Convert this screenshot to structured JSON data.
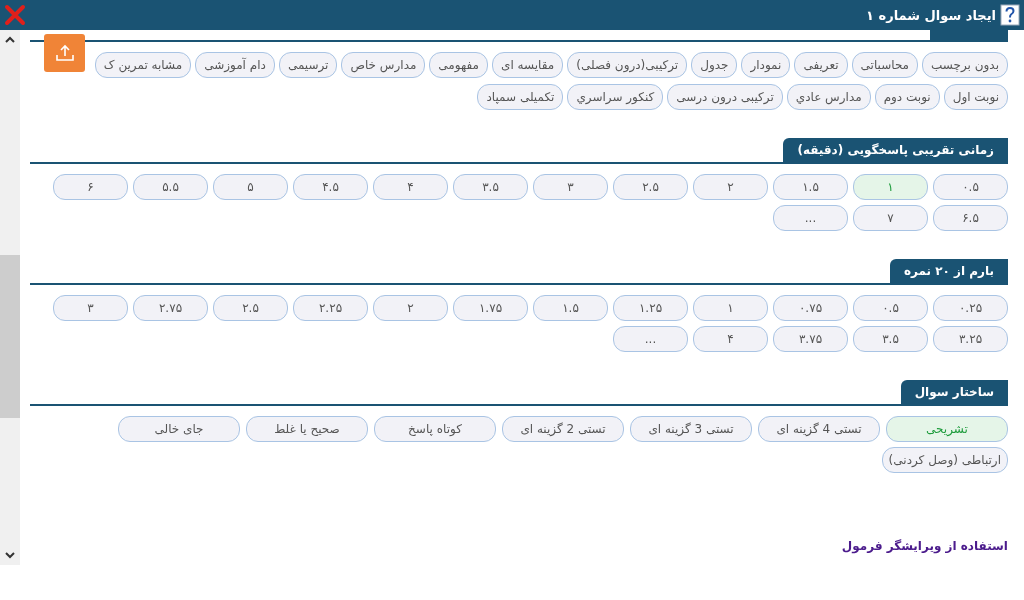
{
  "window": {
    "title": "ایجاد سوال شماره ۱"
  },
  "sections": [
    {
      "kind": "tags",
      "items": [
        {
          "label": "بدون برچسب",
          "selected": false
        },
        {
          "label": "محاسباتی",
          "selected": false
        },
        {
          "label": "تعریفی",
          "selected": false
        },
        {
          "label": "نمودار",
          "selected": false
        },
        {
          "label": "جدول",
          "selected": false
        },
        {
          "label": "ترکیبی(درون فصلی)",
          "selected": false
        },
        {
          "label": "مقایسه ای",
          "selected": false
        },
        {
          "label": "مفهومی",
          "selected": false
        },
        {
          "label": "مدارس خاص",
          "selected": false
        },
        {
          "label": "ترسیمی",
          "selected": false
        },
        {
          "label": "دام آموزشی",
          "selected": false
        },
        {
          "label": "مشابه تمرین ک",
          "selected": false
        },
        {
          "label": "نوبت اول",
          "selected": false
        },
        {
          "label": "نوبت دوم",
          "selected": false
        },
        {
          "label": "مدارس عادي",
          "selected": false
        },
        {
          "label": "ترکیبی درون درسی",
          "selected": false
        },
        {
          "label": "کنکور سراسري",
          "selected": false
        },
        {
          "label": "تکمیلی سمپاد",
          "selected": false
        }
      ]
    },
    {
      "kind": "grid",
      "title": "زمانی تقریبی پاسخگویی (دقیقه)",
      "items": [
        {
          "label": "۰.۵",
          "selected": false
        },
        {
          "label": "۱",
          "selected": true
        },
        {
          "label": "۱.۵",
          "selected": false
        },
        {
          "label": "۲",
          "selected": false
        },
        {
          "label": "۲.۵",
          "selected": false
        },
        {
          "label": "۳",
          "selected": false
        },
        {
          "label": "۳.۵",
          "selected": false
        },
        {
          "label": "۴",
          "selected": false
        },
        {
          "label": "۴.۵",
          "selected": false
        },
        {
          "label": "۵",
          "selected": false
        },
        {
          "label": "۵.۵",
          "selected": false
        },
        {
          "label": "۶",
          "selected": false
        },
        {
          "label": "۶.۵",
          "selected": false
        },
        {
          "label": "۷",
          "selected": false
        },
        {
          "label": "...",
          "selected": false
        }
      ]
    },
    {
      "kind": "grid",
      "title": "بارم از ۲۰ نمره",
      "items": [
        {
          "label": "۰.۲۵",
          "selected": false
        },
        {
          "label": "۰.۵",
          "selected": false
        },
        {
          "label": "۰.۷۵",
          "selected": false
        },
        {
          "label": "۱",
          "selected": false
        },
        {
          "label": "۱.۲۵",
          "selected": false
        },
        {
          "label": "۱.۵",
          "selected": false
        },
        {
          "label": "۱.۷۵",
          "selected": false
        },
        {
          "label": "۲",
          "selected": false
        },
        {
          "label": "۲.۲۵",
          "selected": false
        },
        {
          "label": "۲.۵",
          "selected": false
        },
        {
          "label": "۲.۷۵",
          "selected": false
        },
        {
          "label": "۳",
          "selected": false
        },
        {
          "label": "۳.۲۵",
          "selected": false
        },
        {
          "label": "۳.۵",
          "selected": false
        },
        {
          "label": "۳.۷۵",
          "selected": false
        },
        {
          "label": "۴",
          "selected": false
        },
        {
          "label": "...",
          "selected": false
        }
      ]
    },
    {
      "kind": "wide",
      "title": "ساختار سوال",
      "items": [
        {
          "label": "تشریحی",
          "selected": true
        },
        {
          "label": "تستی 4 گزینه ای",
          "selected": false
        },
        {
          "label": "تستی 3 گزینه ای",
          "selected": false
        },
        {
          "label": "تستی 2 گزینه ای",
          "selected": false
        },
        {
          "label": "کوتاه پاسخ",
          "selected": false
        },
        {
          "label": "صحیح یا غلط",
          "selected": false
        },
        {
          "label": "جای خالی",
          "selected": false
        },
        {
          "label": "ارتباطی (وصل کردنی)",
          "selected": false
        }
      ]
    }
  ],
  "formula_link": "استفاده از ویرایشگر فرمول"
}
